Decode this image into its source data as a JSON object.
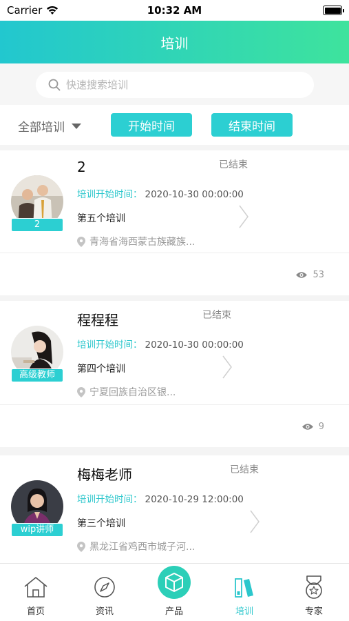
{
  "status_bar": {
    "carrier": "Carrier",
    "time": "10:32 AM"
  },
  "header": {
    "title": "培训"
  },
  "search": {
    "placeholder": "快速搜索培训"
  },
  "filters": {
    "all_label": "全部培训",
    "start_label": "开始时间",
    "end_label": "结束时间"
  },
  "time_label": "培训开始时间：",
  "cards": [
    {
      "name": "2",
      "status": "已结束",
      "badge": "2",
      "time": "2020-10-30 00:00:00",
      "title": "第五个培训",
      "location": "青海省海西蒙古族藏族...",
      "views": "53"
    },
    {
      "name": "程程程",
      "status": "已结束",
      "badge": "高级教师",
      "time": "2020-10-30 00:00:00",
      "title": "第四个培训",
      "location": "宁夏回族自治区银...",
      "views": "9"
    },
    {
      "name": "梅梅老师",
      "status": "已结束",
      "badge": "wip讲师",
      "time": "2020-10-29 12:00:00",
      "title": "第三个培训",
      "location": "黑龙江省鸡西市城子河...",
      "views": ""
    }
  ],
  "tabs": [
    {
      "label": "首页",
      "icon": "home-icon"
    },
    {
      "label": "资讯",
      "icon": "compass-icon"
    },
    {
      "label": "产品",
      "icon": "box-icon"
    },
    {
      "label": "培训",
      "icon": "books-icon",
      "active": true
    },
    {
      "label": "专家",
      "icon": "medal-icon"
    }
  ],
  "colors": {
    "accent": "#2ccfd2",
    "header_start": "#22c7cf",
    "header_end": "#3ee39d"
  }
}
